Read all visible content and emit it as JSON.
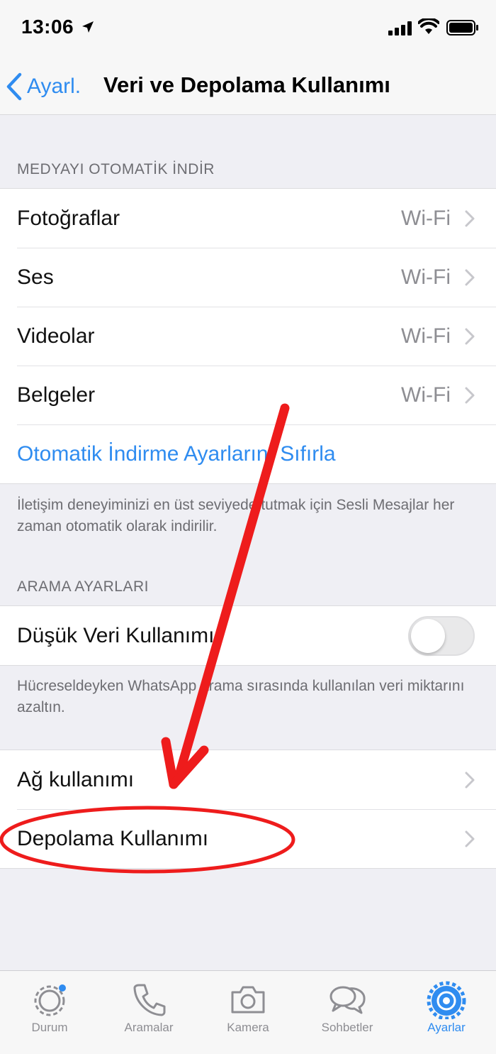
{
  "status_bar": {
    "time": "13:06"
  },
  "nav": {
    "back_label": "Ayarl.",
    "title": "Veri ve Depolama Kullanımı"
  },
  "media_section": {
    "header": "MEDYAYI OTOMATİK İNDİR",
    "items": [
      {
        "label": "Fotoğraflar",
        "value": "Wi-Fi"
      },
      {
        "label": "Ses",
        "value": "Wi-Fi"
      },
      {
        "label": "Videolar",
        "value": "Wi-Fi"
      },
      {
        "label": "Belgeler",
        "value": "Wi-Fi"
      }
    ],
    "reset_label": "Otomatik İndirme Ayarlarını Sıfırla",
    "footer": "İletişim deneyiminizi en üst seviyede tutmak için Sesli Mesajlar her zaman otomatik olarak indirilir."
  },
  "call_section": {
    "header": "ARAMA AYARLARI",
    "low_data_label": "Düşük Veri Kullanımı",
    "low_data_enabled": false,
    "footer": "Hücreseldeyken WhatsApp arama sırasında kullanılan veri miktarını azaltın."
  },
  "usage_section": {
    "items": [
      {
        "label": "Ağ kullanımı"
      },
      {
        "label": "Depolama Kullanımı"
      }
    ]
  },
  "tab_bar": {
    "tabs": [
      {
        "label": "Durum",
        "icon": "status-icon"
      },
      {
        "label": "Aramalar",
        "icon": "phone-icon"
      },
      {
        "label": "Kamera",
        "icon": "camera-icon"
      },
      {
        "label": "Sohbetler",
        "icon": "chats-icon"
      },
      {
        "label": "Ayarlar",
        "icon": "gear-icon"
      }
    ],
    "active_index": 4
  },
  "colors": {
    "accent": "#2f8cf0",
    "annotation": "#ee1c1c",
    "background": "#efeff4"
  }
}
